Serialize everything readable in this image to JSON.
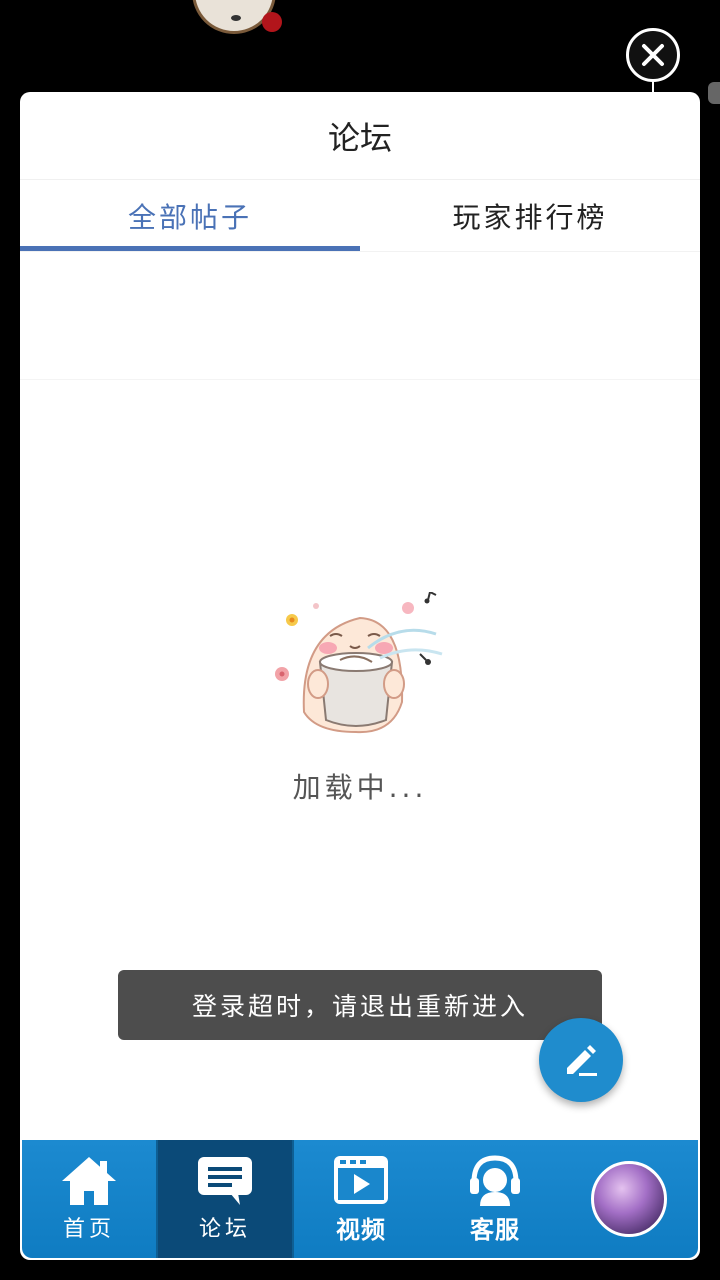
{
  "header": {
    "title": "论坛"
  },
  "tabs": [
    {
      "label": "全部帖子",
      "active": true
    },
    {
      "label": "玩家排行榜",
      "active": false
    }
  ],
  "loading": {
    "text": "加载中..."
  },
  "toast": {
    "message": "登录超时，请退出重新进入"
  },
  "bottom_nav": {
    "items": [
      {
        "label": "首页",
        "icon": "home-icon",
        "active": false
      },
      {
        "label": "论坛",
        "icon": "chat-icon",
        "active": true
      },
      {
        "label": "视频",
        "icon": "video-icon",
        "active": false
      },
      {
        "label": "客服",
        "icon": "headset-icon",
        "active": false
      }
    ],
    "avatar": "user-avatar"
  },
  "colors": {
    "accent": "#4a72b6",
    "nav_bg": "#1c8ad0",
    "nav_active": "#0b4a78",
    "fab": "#1f8ccd",
    "toast_bg": "#4d4d4d"
  },
  "icons": {
    "close": "close-icon",
    "compose": "pencil-icon"
  }
}
